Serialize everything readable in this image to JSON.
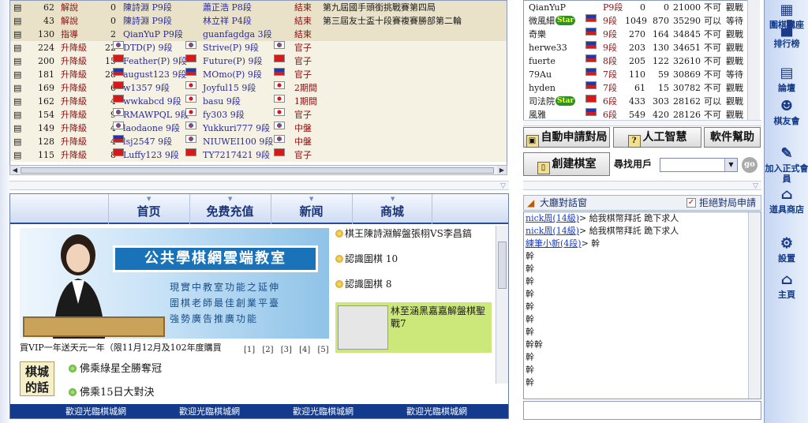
{
  "games": [
    {
      "num": "62",
      "status": "解說",
      "moves": "0",
      "black": "陳詩淵 P9段",
      "bflag": "",
      "white": "蕭正浩 P8段",
      "wflag": "",
      "result": "結束",
      "comment": "第九屆國手頭銜挑戰賽第四局",
      "style": "hi"
    },
    {
      "num": "43",
      "status": "解說",
      "moves": "0",
      "black": "陳詩淵 P9段",
      "bflag": "",
      "white": "林立祥 P4段",
      "wflag": "",
      "result": "結束",
      "comment": "第三屆友士盃十段賽複賽勝部第二輪",
      "style": "hi"
    },
    {
      "num": "130",
      "status": "指導",
      "moves": "2",
      "black": "QianYuP P9段",
      "bflag": "",
      "white": "guanfagdga 3段",
      "wflag": "",
      "result": "結束",
      "comment": "",
      "style": "hi"
    },
    {
      "num": "224",
      "status": "升降級",
      "moves": "22",
      "black": "DTD(P) 9段",
      "bflag": "kr",
      "white": "Strive(P) 9段",
      "wflag": "kr",
      "result": "官子",
      "comment": "",
      "style": "stripe"
    },
    {
      "num": "200",
      "status": "升降級",
      "moves": "15",
      "black": "Feather(P) 9段",
      "bflag": "cn",
      "white": "Future(P) 9段",
      "wflag": "cn",
      "result": "官子",
      "comment": "",
      "style": "stripe"
    },
    {
      "num": "181",
      "status": "升降級",
      "moves": "28",
      "black": "august123 9段",
      "bflag": "tw",
      "white": "MOmo(P) 9段",
      "wflag": "tw",
      "result": "官子",
      "comment": "",
      "style": "stripe"
    },
    {
      "num": "169",
      "status": "升降級",
      "moves": "6",
      "black": "w1357 9段",
      "bflag": "cn",
      "white": "Joyful15 9段",
      "wflag": "jp",
      "result": "2期間",
      "comment": "",
      "style": "stripe"
    },
    {
      "num": "162",
      "status": "升降級",
      "moves": "4",
      "black": "wwkabcd 9段",
      "bflag": "cn",
      "white": "basu 9段",
      "wflag": "jp",
      "result": "1期間",
      "comment": "",
      "style": "stripe"
    },
    {
      "num": "154",
      "status": "升降級",
      "moves": "9",
      "black": "RMAWPQL 9段",
      "bflag": "kr",
      "white": "fy303 9段",
      "wflag": "jp",
      "result": "官子",
      "comment": "",
      "style": "stripe"
    },
    {
      "num": "149",
      "status": "升降級",
      "moves": "4",
      "black": "laodaone 9段",
      "bflag": "kr",
      "white": "Yukkuri777 9段",
      "wflag": "kr",
      "result": "中盤",
      "comment": "",
      "style": "stripe"
    },
    {
      "num": "128",
      "status": "升降級",
      "moves": "4",
      "black": "lsj2547 9段",
      "bflag": "tw",
      "white": "NIUWEI100 9段",
      "wflag": "kr",
      "result": "中盤",
      "comment": "",
      "style": "stripe"
    },
    {
      "num": "115",
      "status": "升降級",
      "moves": "8",
      "black": "Luffy123 9段",
      "bflag": "cn",
      "white": "TY7217421 9段",
      "wflag": "cn",
      "result": "官子",
      "comment": "",
      "style": "stripe"
    }
  ],
  "users": [
    {
      "name": "QianYuP",
      "flag": "",
      "rank": "P9段",
      "w": "0",
      "l": "0",
      "pts": "21000",
      "chal": "不可",
      "act": "觀戰",
      "star": false
    },
    {
      "name": "微風細",
      "flag": "tw",
      "rank": "9段",
      "w": "1049",
      "l": "870",
      "pts": "35290",
      "chal": "可以",
      "act": "等待",
      "star": true
    },
    {
      "name": "奇樂",
      "flag": "tw",
      "rank": "9段",
      "w": "270",
      "l": "164",
      "pts": "34845",
      "chal": "不可",
      "act": "觀戰",
      "star": false
    },
    {
      "name": "herwe33",
      "flag": "tw",
      "rank": "9段",
      "w": "203",
      "l": "130",
      "pts": "34651",
      "chal": "不可",
      "act": "觀戰",
      "star": false
    },
    {
      "name": "fuerte",
      "flag": "tw",
      "rank": "8段",
      "w": "205",
      "l": "122",
      "pts": "32610",
      "chal": "不可",
      "act": "觀戰",
      "star": false
    },
    {
      "name": "79Au",
      "flag": "tw",
      "rank": "7段",
      "w": "110",
      "l": "59",
      "pts": "30869",
      "chal": "不可",
      "act": "等待",
      "star": false
    },
    {
      "name": "hyden",
      "flag": "tw",
      "rank": "7段",
      "w": "61",
      "l": "15",
      "pts": "30782",
      "chal": "不可",
      "act": "觀戰",
      "star": false
    },
    {
      "name": "司法院",
      "flag": "cn",
      "rank": "6段",
      "w": "433",
      "l": "303",
      "pts": "28162",
      "chal": "可以",
      "act": "觀戰",
      "star": true
    },
    {
      "name": "風雅",
      "flag": "tw",
      "rank": "6段",
      "w": "549",
      "l": "420",
      "pts": "28126",
      "chal": "不可",
      "act": "觀戰",
      "star": false
    }
  ],
  "buttons": {
    "auto_match": "自動申請對局",
    "ai": "人工智慧",
    "help": "軟件幫助",
    "create_room": "創建棋室",
    "find_user": "尋找用戶",
    "go": "go"
  },
  "nav": [
    "首页",
    "免费充值",
    "新闻",
    "商城"
  ],
  "banner": {
    "title": "公共學棋網雲端教室",
    "line1": "現實中教室功能之延伸",
    "line2": "圍棋老師最佳創業平臺",
    "line3": "強勢廣告推廣功能"
  },
  "news": [
    "棋王陳詩淵解盤張栩VS李昌鎬",
    "認識圍棋 10",
    "認識圍棋 8"
  ],
  "news_highlight": "林至涵黑嘉嘉解盤棋聖戰7",
  "promo": "買VIP一年送天元一年（限11月12月及102年度購買",
  "pager": [
    "[1]",
    "[2]",
    "[3]",
    "[4]",
    "[5]"
  ],
  "word_box": [
    "棋城",
    "的話"
  ],
  "bullets": [
    "佛乘綠星全勝奪冠",
    "佛乘15日大對決"
  ],
  "ticker": [
    "歡迎光臨棋城網",
    "歡迎光臨棋城網",
    "歡迎光臨棋城網",
    "歡迎光臨棋城網"
  ],
  "chat": {
    "title": "大廳對話窗",
    "refuse": "拒絕對局申請",
    "lines": [
      {
        "nick": "nick周(14級)",
        "text": "> 給我棋幣拜託 跪下求人"
      },
      {
        "nick": "nick周(14級)",
        "text": "> 給我棋幣拜託 跪下求人"
      },
      {
        "nick": "練筆小新(4段)",
        "text": "> 幹"
      },
      {
        "nick": "",
        "text": "幹"
      },
      {
        "nick": "",
        "text": "幹"
      },
      {
        "nick": "",
        "text": "幹"
      },
      {
        "nick": "",
        "text": "幹"
      },
      {
        "nick": "",
        "text": "幹"
      },
      {
        "nick": "",
        "text": "幹"
      },
      {
        "nick": "",
        "text": "幹"
      },
      {
        "nick": "",
        "text": "幹幹"
      },
      {
        "nick": "",
        "text": "幹"
      },
      {
        "nick": "",
        "text": "幹"
      },
      {
        "nick": "",
        "text": "幹"
      }
    ]
  },
  "toolbar": [
    {
      "icon": "board-icon",
      "glyph": "▦",
      "label": "圍棋講座"
    },
    {
      "icon": "ranking-icon",
      "glyph": "▟",
      "label": "排行榜"
    },
    {
      "icon": "forum-icon",
      "glyph": "▤",
      "label": "論壇"
    },
    {
      "icon": "friends-icon",
      "glyph": "☻",
      "label": "棋友會"
    },
    {
      "icon": "join-member-icon",
      "glyph": "✎",
      "label": "加入正式會員"
    },
    {
      "icon": "shop-icon",
      "glyph": "⌂",
      "label": "道具商店"
    },
    {
      "icon": "settings-icon",
      "glyph": "⚙",
      "label": "設置"
    },
    {
      "icon": "home-icon",
      "glyph": "⌂",
      "label": "主頁"
    }
  ],
  "colors": {
    "status": "#8a1010",
    "player": "#2b2b9a",
    "nav_text": "#1a3476",
    "ticker_bg": "#133a8c",
    "nick": "#1a3cc4"
  }
}
